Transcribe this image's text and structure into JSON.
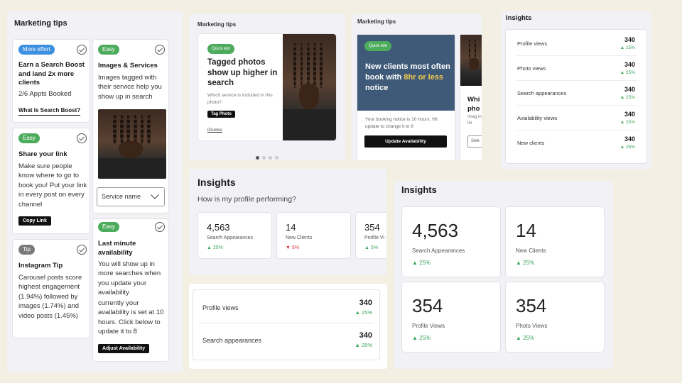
{
  "tips_panel": {
    "title": "Marketing tips",
    "cards": {
      "search_boost": {
        "badge": "More effort",
        "title": "Earn a Search Boost and land 2x more clients",
        "subtitle": "2/6 Appts Booked",
        "link": "What Is Search Boost?"
      },
      "share_link": {
        "badge": "Easy",
        "title": "Share your link",
        "text": "Make sure people know where to go to book you! Put your link in every post on every channel",
        "button": "Copy Link"
      },
      "instagram": {
        "badge": "Tip",
        "title": "Instagram Tip",
        "text": "Carousel posts score highest engagement (1.94%) followed by images (1.74%) and video posts (1.45%)"
      },
      "images_services": {
        "badge": "Easy",
        "title": "Images & Services",
        "text": "Images tagged with their service help you show up in search",
        "select_placeholder": "Service name"
      },
      "last_minute": {
        "badge": "Easy",
        "title": "Last minute availability",
        "text1": "You will show up in more searches when you update your availability",
        "text2": "currently your availability is set at 10 hours. Click below to update it to 8",
        "button": "Adjust Availability"
      }
    }
  },
  "carousel1": {
    "title": "Marketing tips",
    "badge": "Quick win",
    "headline": "Tagged photos show up higher in search",
    "question": "Which service is included in this photo?",
    "button": "Tag Photo",
    "dismiss": "Dismiss",
    "dots": 4
  },
  "carousel2": {
    "title": "Marketing tips",
    "badge": "Quick win",
    "headline_a": "New clients most often book with",
    "headline_b": "8hr or less",
    "headline_c": "notice",
    "body": "Your booking notice is 10 hours. Hit update to change it to 8",
    "button": "Update Availability",
    "peek_title": "Whi pho",
    "peek_text": "Imag in thi",
    "peek_btn": "Sele",
    "colors": {
      "card_bg": "#3f5a78",
      "accent": "#f2c84b"
    }
  },
  "insights_list": {
    "title": "Insights",
    "rows": [
      {
        "label": "Profile views",
        "value": "340",
        "pct": "25%"
      },
      {
        "label": "Photo views",
        "value": "340",
        "pct": "25%"
      },
      {
        "label": "Search appearances",
        "value": "340",
        "pct": "25%"
      },
      {
        "label": "Availability views",
        "value": "340",
        "pct": "25%"
      },
      {
        "label": "New clients",
        "value": "340",
        "pct": "25%"
      }
    ]
  },
  "insights_mid": {
    "title": "Insights",
    "question": "How is my profile performing?",
    "cards": [
      {
        "value": "4,563",
        "label": "Search Appearances",
        "pct": "25%",
        "dir": "up"
      },
      {
        "value": "14",
        "label": "New Clients",
        "pct": "5%",
        "dir": "down"
      },
      {
        "value": "354",
        "label": "Profile Vi",
        "pct": "5%",
        "dir": "up"
      }
    ]
  },
  "insights_small": {
    "rows": [
      {
        "label": "Profile views",
        "value": "340",
        "pct": "25%"
      },
      {
        "label": "Search appearances",
        "value": "340",
        "pct": "25%"
      }
    ]
  },
  "insights_grid": {
    "title": "Insights",
    "cards": [
      {
        "value": "4,563",
        "label": "Search Appearances",
        "pct": "25%"
      },
      {
        "value": "14",
        "label": "New Clients",
        "pct": "25%"
      },
      {
        "value": "354",
        "label": "Profile Views",
        "pct": "25%"
      },
      {
        "value": "354",
        "label": "Photo Views",
        "pct": "25%"
      }
    ]
  },
  "icons": {
    "check": "check-circle-icon",
    "up": "arrow-up-icon",
    "down": "arrow-down-icon",
    "chevron": "chevron-down-icon"
  }
}
